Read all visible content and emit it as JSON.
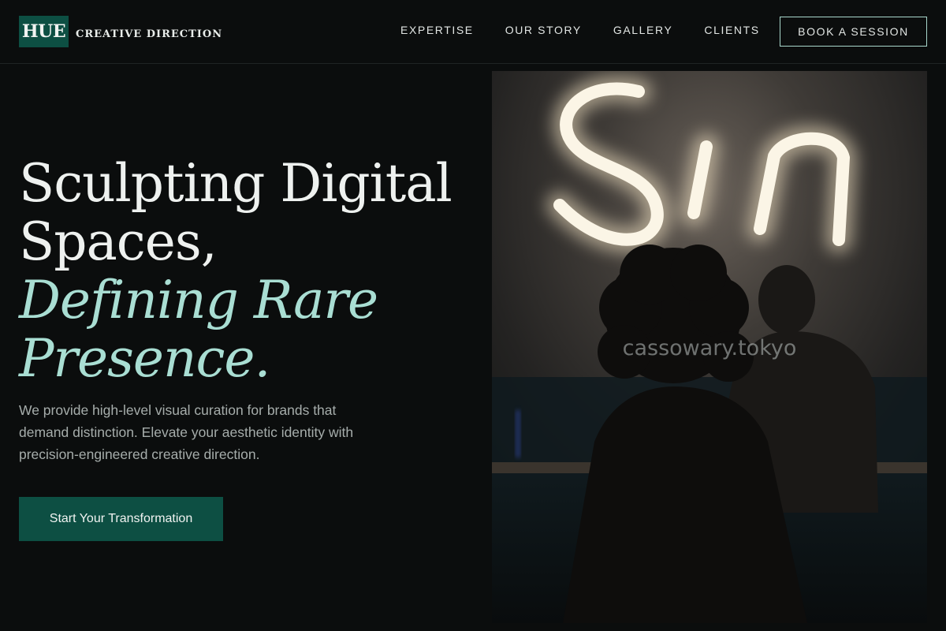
{
  "header": {
    "logo_text": "HUE",
    "logo_subtitle": "CREATIVE DIRECTION",
    "nav": [
      {
        "label": "EXPERTISE"
      },
      {
        "label": "OUR STORY"
      },
      {
        "label": "GALLERY"
      },
      {
        "label": "CLIENTS"
      }
    ],
    "cta_label": "BOOK A SESSION"
  },
  "hero": {
    "title_line1": "Sculpting Digital",
    "title_line2": "Spaces,",
    "title_accent1": "Defining Rare",
    "title_accent2": "Presence.",
    "description": "We provide high-level visual curation for brands that demand distinction. Elevate your aesthetic identity with precision-engineered creative direction.",
    "button_label": "Start Your Transformation"
  },
  "photo": {
    "watermark": "cassowary.tokyo"
  },
  "colors": {
    "background": "#0b0d0d",
    "brand_green": "#0d4f43",
    "accent_mint": "#a9ded3",
    "text_muted": "#a6adab"
  }
}
